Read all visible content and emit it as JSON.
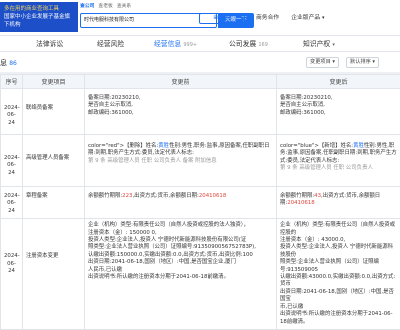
{
  "brand": {
    "line1": "多在用的商业查询工具",
    "line2": "国家中小企业发展子基金旗下机构"
  },
  "search": {
    "tabs": [
      "查公司",
      "查老板",
      "查关系"
    ],
    "query": "时代电服科技有限公司",
    "button": "天眼一下"
  },
  "header": {
    "app_button": "应用",
    "nav": [
      "商务合作",
      "企业版产品"
    ]
  },
  "module_tabs": [
    {
      "label": "法律诉讼",
      "count": "",
      "active": false
    },
    {
      "label": "经营风险",
      "count": "",
      "active": false
    },
    {
      "label": "经营信息",
      "count": "999+",
      "active": true
    },
    {
      "label": "公司发展",
      "count": "169",
      "active": false
    },
    {
      "label": "知识产权",
      "count": "",
      "active": false
    }
  ],
  "history": {
    "title": "息",
    "count": "86",
    "filter": "变更项目",
    "sort": "默认排序",
    "export": "导出数据"
  },
  "columns": [
    "序号",
    "变更项目",
    "变更前",
    "变更后"
  ],
  "rows": [
    {
      "num": "9",
      "date": "2024-06-24",
      "project": "联络员备案",
      "before": [
        "备案日期:20230210,",
        "是否自主公示取消,",
        "邮政编码:361000,"
      ],
      "after": [
        "备案日期:20230210,",
        "是否自主公示取消,",
        "邮政编码:361000,"
      ]
    },
    {
      "num": "10",
      "date": "2024-06-24",
      "project": "高级管理人员备案",
      "before_prefix": "color=\"red\">【删除】姓名:",
      "before_name": "黄胜",
      "before_rest": "性别:男性,职务:监事,原因备案,任职副职日期:到期,职务产生方式:委员,法定代表人标志:",
      "before_gray": "第 9 条 高级管理人员 任职 公司负责人 备案 附加信息",
      "after_prefix": "color=\"blue\">【新增】姓名:",
      "after_name": "黄胜",
      "after_rest": "性别:男性,职务:监事,原因备案,任职副职日期:到期,职务产生方式:委员,法定代表人标志:",
      "after_gray": "第 9 条 高级管理人员 任职 公司负责人"
    },
    {
      "num": "11",
      "date": "2024-06-24",
      "project": "章程备案",
      "before_prefix": "余额额竹期限:",
      "before_hl1": "223",
      "before_mid": ",出资方式:货币,余额额日期:",
      "before_hl2": "20410618",
      "after_prefix": "余额额竹期限:",
      "after_hl1": "43",
      "after_mid": ",出资方式:货币,余额额日期:",
      "after_hl2": "20410618"
    },
    {
      "num": "12",
      "date": "2024-06-24",
      "project": "注册资本变更",
      "before": [
        "企业（机构）类型:有限责任公司（自然人投资或控股的法人独资），",
        "注册资本（金）: 150000 0,",
        "投资人类型:企业法人,投资人 宁德时代新能源科技股份有限公司(证",
        "照类型:企业法人营业执照（公司）证照编号:9135090056752783P),",
        "认缴出资额:150000.0,实缴出资额:0.0,出资方式:货币,出资比例:100",
        "出资日期:2041-06-18,国别（地区）:中国,是否国宝企业,厦门",
        "人民币,已认缴",
        "出资说明书:所认缴的注册资本分期于2041-06-18前缴清。"
      ],
      "after": [
        "企业（机构）类型:有限责任公司（自然人投资或控股的",
        "注册资本（金）: 43000.0,",
        "投资人类型:企业法人,投资人 宁德时代新能源科技股份",
        "照类型:企业法人营业执照（公司）证照编号:913509005",
        "认缴出资额:43000.0,实缴出资额:0.0,出资方式:货币",
        "出资日期:2041-06-18,国别（地区）:中国,是否国宝",
        "币,已认缴",
        "出资说明书:所认缴的注册资本分期于2041-06-18前缴清。"
      ]
    }
  ]
}
